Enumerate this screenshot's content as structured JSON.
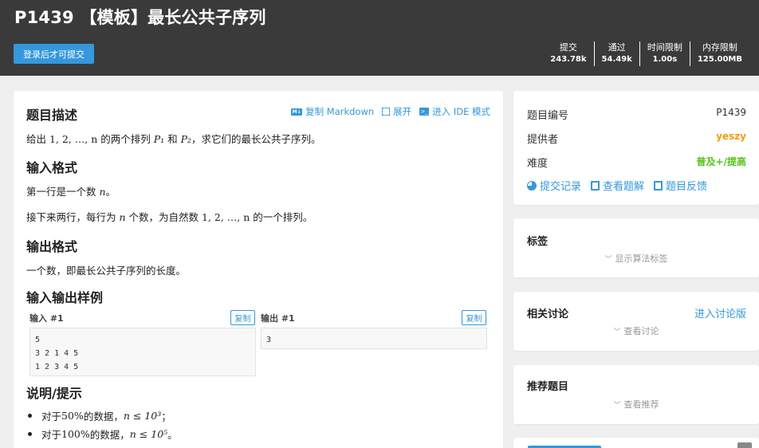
{
  "header": {
    "title": "P1439 【模板】最长公共子序列",
    "login_button": "登录后才可提交",
    "stats": [
      {
        "label": "提交",
        "value": "243.78k"
      },
      {
        "label": "通过",
        "value": "54.49k"
      },
      {
        "label": "时间限制",
        "value": "1.00s"
      },
      {
        "label": "内存限制",
        "value": "125.00MB"
      }
    ]
  },
  "problem": {
    "actions": {
      "copy_markdown": "复制 Markdown",
      "expand": "展开",
      "ide_mode": "进入 IDE 模式",
      "md_icon_text": "M↓",
      "ide_icon_text": ">_"
    },
    "description_title": "题目描述",
    "description": {
      "pre": "给出 ",
      "seq": "1, 2, …, n",
      "mid": " 的两个排列 ",
      "p1": "P₁",
      "and": " 和 ",
      "p2": "P₂",
      "post": "，求它们的最长公共子序列。"
    },
    "input_title": "输入格式",
    "input_line1": {
      "pre": "第一行是一个数 ",
      "n": "n",
      "post": "。"
    },
    "input_line2": {
      "pre": "接下来两行，每行为 ",
      "n": "n",
      "mid": " 个数，为自然数 ",
      "seq": "1, 2, …, n",
      "post": " 的一个排列。"
    },
    "output_title": "输出格式",
    "output_text": "一个数，即最长公共子序列的长度。",
    "samples_title": "输入输出样例",
    "sample_input_label": "输入 #1",
    "sample_output_label": "输出 #1",
    "copy_label": "复制",
    "sample_input": "5 \n3 2 1 4 5\n1 2 3 4 5",
    "sample_output": "3",
    "hint_title": "说明/提示",
    "hints": [
      {
        "pre": "对于 ",
        "pct": "50%",
        "mid": " 的数据， ",
        "cond": "n ≤ 10³",
        "post": "；"
      },
      {
        "pre": "对于 ",
        "pct": "100%",
        "mid": " 的数据， ",
        "cond": "n ≤ 10⁵",
        "post": "。"
      }
    ]
  },
  "info": {
    "id_label": "题目编号",
    "id_value": "P1439",
    "provider_label": "提供者",
    "provider_value": "yeszy",
    "difficulty_label": "难度",
    "difficulty_value": "普及+/提高",
    "links": [
      "提交记录",
      "查看题解",
      "题目反馈"
    ]
  },
  "tags": {
    "title": "标签",
    "toggle": "显示算法标签"
  },
  "discussion": {
    "title": "相关讨论",
    "link": "进入讨论版",
    "toggle": "查看讨论"
  },
  "recommend": {
    "title": "推荐题目",
    "toggle": "查看推荐"
  },
  "colors": {
    "header_bg": "#3a3a3a",
    "accent": "#3498db",
    "provider": "#f39c11",
    "difficulty": "#52c41a"
  },
  "icons": {
    "chevron": "﹀"
  }
}
